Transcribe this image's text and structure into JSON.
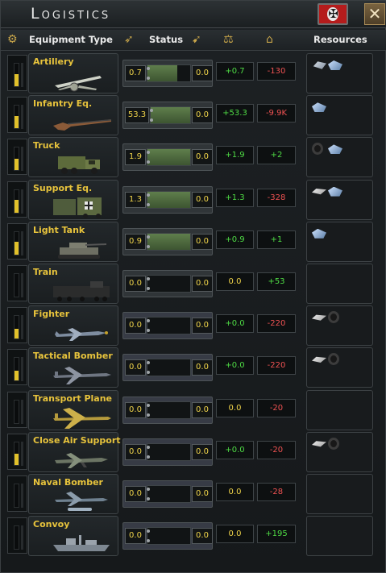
{
  "window": {
    "title": "Logistics",
    "flag_icon": "german-reich-flag-icon",
    "close_icon": "close-x-icon"
  },
  "header": {
    "equipment_type_label": "Equipment Type",
    "status_label": "Status",
    "resources_label": "Resources",
    "icons": [
      "equipment-type-icon",
      "status-gun-icon",
      "status-rifle-icon",
      "balance-scale-icon",
      "factory-building-icon"
    ]
  },
  "rows": [
    {
      "name": "Artillery",
      "icon": "artillery-gun-icon",
      "stock": "0.7",
      "fill": 0.7,
      "right": "0.0",
      "change": "+0.7",
      "net": "-130",
      "net_sign": "neg",
      "change_sign": "pos",
      "readiness": 0.55,
      "resources": [
        "steel",
        "aluminium"
      ],
      "label_extra": "I"
    },
    {
      "name": "Infantry Eq.",
      "icon": "rifle-icon",
      "stock": "53.3",
      "fill": 1.0,
      "right": "0.0",
      "change": "+53.3",
      "net": "-9.9K",
      "net_sign": "neg",
      "change_sign": "pos",
      "readiness": 0.55,
      "resources": [
        "aluminium"
      ]
    },
    {
      "name": "Truck",
      "icon": "truck-icon",
      "stock": "1.9",
      "fill": 1.0,
      "right": "0.0",
      "change": "+1.9",
      "net": "+2",
      "net_sign": "pos",
      "change_sign": "pos",
      "readiness": 0.5,
      "resources": [
        "rubber",
        "aluminium"
      ]
    },
    {
      "name": "Support Eq.",
      "icon": "support-equipment-icon",
      "stock": "1.3",
      "fill": 1.0,
      "right": "0.0",
      "change": "+1.3",
      "net": "-328",
      "net_sign": "neg",
      "change_sign": "pos",
      "readiness": 0.55,
      "resources": [
        "tungsten",
        "aluminium"
      ]
    },
    {
      "name": "Light Tank",
      "icon": "light-tank-icon",
      "stock": "0.9",
      "fill": 1.0,
      "right": "0.0",
      "change": "+0.9",
      "net": "+1",
      "net_sign": "pos",
      "change_sign": "pos",
      "readiness": 0.55,
      "resources": [
        "aluminium"
      ]
    },
    {
      "name": "Train",
      "icon": "train-icon",
      "stock": "0.0",
      "fill": 0.0,
      "right": "0.0",
      "change": "0.0",
      "net": "+53",
      "net_sign": "pos",
      "change_sign": "neu",
      "readiness": 0.0,
      "resources": []
    },
    {
      "name": "Fighter",
      "icon": "fighter-plane-icon",
      "stock": "0.0",
      "fill": 0.0,
      "right": "0.0",
      "change": "+0.0",
      "net": "-220",
      "net_sign": "neg",
      "change_sign": "pos",
      "readiness": 0.45,
      "resources": [
        "tungsten",
        "rubber"
      ],
      "blue": true
    },
    {
      "name": "Tactical Bomber",
      "icon": "tactical-bomber-icon",
      "stock": "0.0",
      "fill": 0.0,
      "right": "0.0",
      "change": "+0.0",
      "net": "-220",
      "net_sign": "neg",
      "change_sign": "pos",
      "readiness": 0.45,
      "resources": [
        "tungsten",
        "rubber"
      ],
      "blue": true
    },
    {
      "name": "Transport Plane",
      "icon": "transport-plane-icon",
      "stock": "0.0",
      "fill": 0.0,
      "right": "0.0",
      "change": "0.0",
      "net": "-20",
      "net_sign": "neg",
      "change_sign": "neu",
      "readiness": 0.0,
      "resources": [],
      "blue": true
    },
    {
      "name": "Close Air Support",
      "icon": "close-air-support-icon",
      "stock": "0.0",
      "fill": 0.0,
      "right": "0.0",
      "change": "+0.0",
      "net": "-20",
      "net_sign": "neg",
      "change_sign": "pos",
      "readiness": 0.5,
      "resources": [
        "tungsten",
        "rubber"
      ],
      "blue": true
    },
    {
      "name": "Naval Bomber",
      "icon": "naval-bomber-icon",
      "stock": "0.0",
      "fill": 0.0,
      "right": "0.0",
      "change": "0.0",
      "net": "-28",
      "net_sign": "neg",
      "change_sign": "neu",
      "readiness": 0.0,
      "resources": [],
      "blue": true
    },
    {
      "name": "Convoy",
      "icon": "convoy-ship-icon",
      "stock": "0.0",
      "fill": 0.0,
      "right": "0.0",
      "change": "0.0",
      "net": "+195",
      "net_sign": "pos",
      "change_sign": "neu",
      "readiness": 0.0,
      "resources": [],
      "blue": true
    }
  ]
}
